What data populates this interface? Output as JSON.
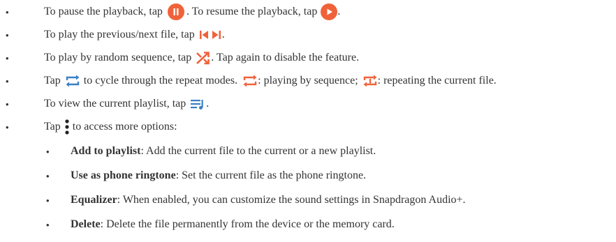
{
  "accent_color": "#f0623a",
  "bullet": "•",
  "items": [
    {
      "a": "To pause the playback, tap",
      "b": ". To resume the playback, tap",
      "c": ".",
      "icon1": "pause-circle-icon",
      "icon2": "play-circle-icon"
    },
    {
      "a": "To play the previous/next file, tap",
      "b": ".",
      "icon1": "previous-next-icon"
    },
    {
      "a": "To play by random sequence, tap",
      "b": ". Tap again to disable the feature.",
      "icon1": "shuffle-icon"
    },
    {
      "a": "Tap",
      "b": "to cycle through the repeat modes.",
      "c": ": playing by sequence;",
      "d": ": repeating the current file.",
      "icon1": "repeat-icon",
      "icon2": "repeat-all-icon",
      "icon3": "repeat-one-icon"
    },
    {
      "a": "To view the current playlist, tap",
      "b": ".",
      "icon1": "playlist-icon"
    },
    {
      "a": "Tap",
      "b": "to access more options:",
      "icon1": "more-options-icon"
    }
  ],
  "sub_items": [
    {
      "term": "Add to playlist",
      "desc": ": Add the current file to the current or a new playlist."
    },
    {
      "term": "Use as phone ringtone",
      "desc": ": Set the current file as the phone ringtone."
    },
    {
      "term": "Equalizer",
      "desc": ": When enabled, you can customize the sound settings in Snapdragon Audio+."
    },
    {
      "term": "Delete",
      "desc": ": Delete the file permanently from the device or the memory card."
    }
  ]
}
